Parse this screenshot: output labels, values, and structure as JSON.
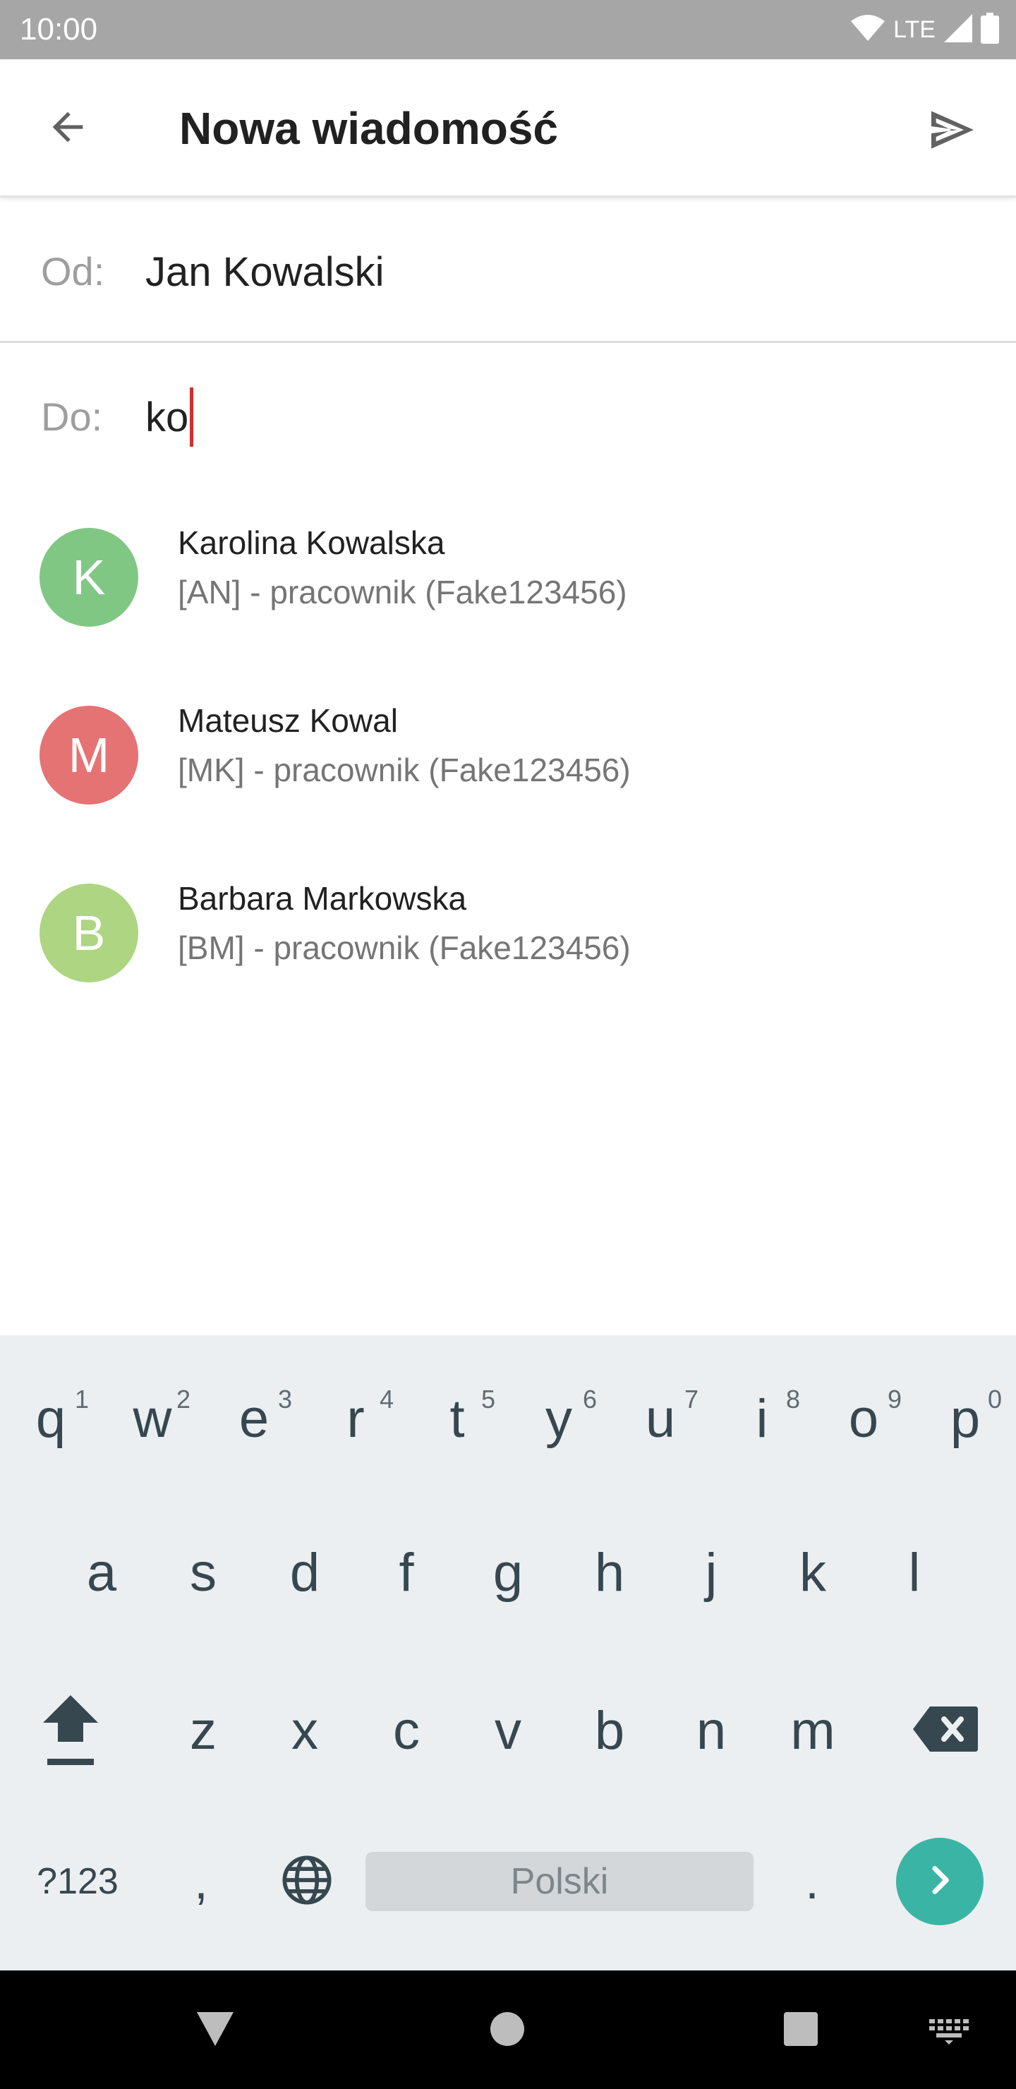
{
  "status": {
    "time": "10:00",
    "network": "LTE"
  },
  "app_bar": {
    "title": "Nowa wiadomość",
    "back_icon": "arrow-back-icon",
    "send_icon": "send-icon"
  },
  "from": {
    "label": "Od:",
    "value": "Jan Kowalski"
  },
  "to": {
    "label": "Do:",
    "value": "ko"
  },
  "suggestions": [
    {
      "initial": "K",
      "name": "Karolina Kowalska",
      "subtitle": "[AN] - pracownik (Fake123456)",
      "color": "#81c784"
    },
    {
      "initial": "M",
      "name": "Mateusz Kowal",
      "subtitle": "[MK] - pracownik (Fake123456)",
      "color": "#e57373"
    },
    {
      "initial": "B",
      "name": "Barbara Markowska",
      "subtitle": "[BM] - pracownik (Fake123456)",
      "color": "#aed581"
    }
  ],
  "keyboard": {
    "row1": [
      "q",
      "w",
      "e",
      "r",
      "t",
      "y",
      "u",
      "i",
      "o",
      "p"
    ],
    "row1_hints": [
      "1",
      "2",
      "3",
      "4",
      "5",
      "6",
      "7",
      "8",
      "9",
      "0"
    ],
    "row2": [
      "a",
      "s",
      "d",
      "f",
      "g",
      "h",
      "j",
      "k",
      "l"
    ],
    "row3": [
      "z",
      "x",
      "c",
      "v",
      "b",
      "n",
      "m"
    ],
    "symbols_label": "?123",
    "comma": ",",
    "period": ".",
    "space_label": "Polski"
  },
  "colors": {
    "accent": "#3ab5a5",
    "caret": "#d32f2f"
  }
}
